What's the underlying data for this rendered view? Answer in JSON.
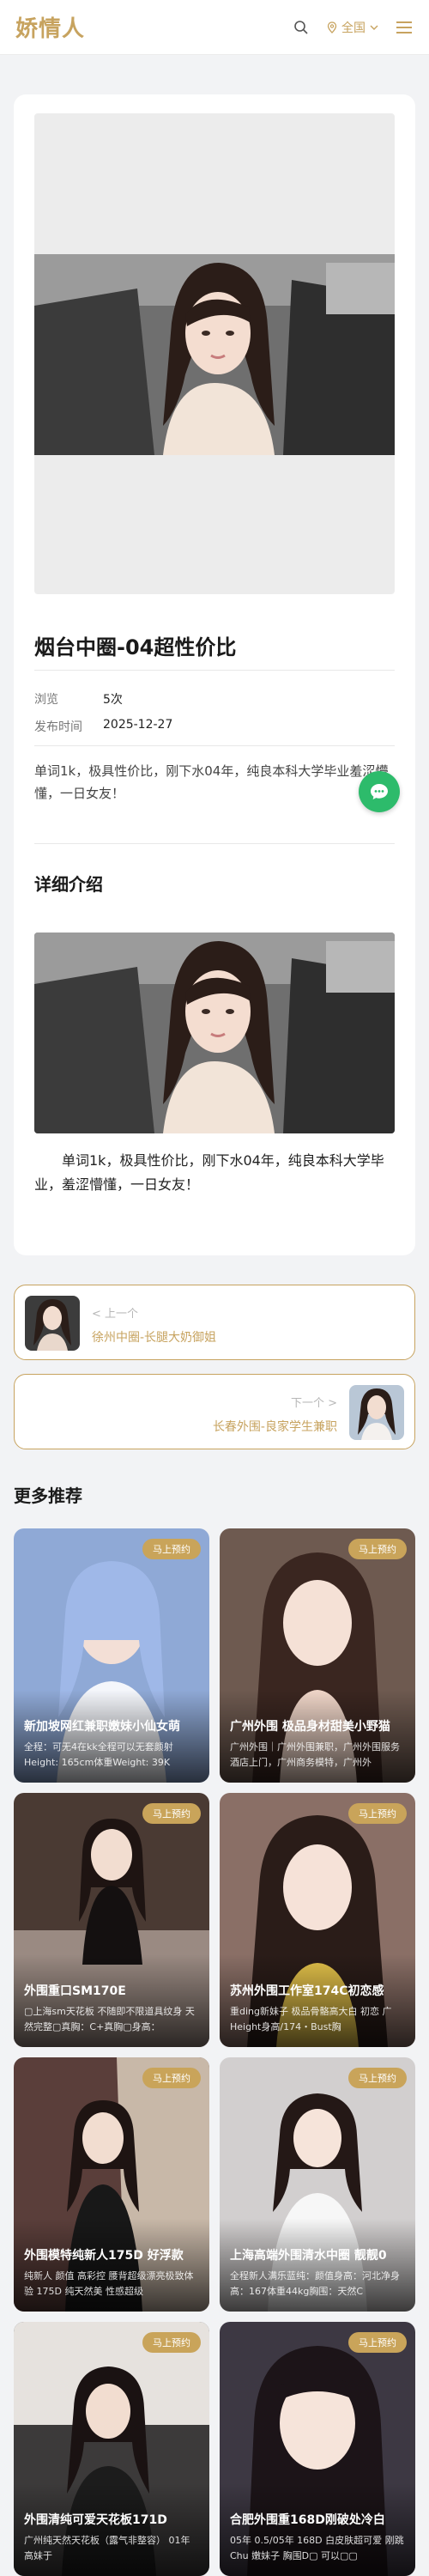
{
  "header": {
    "logo": "娇情人",
    "region_label": "全国",
    "icons": [
      "search-icon",
      "location-pin-icon",
      "chevron-down-icon",
      "menu-icon"
    ],
    "accent_color": "#c7a35f"
  },
  "post": {
    "title": "烟台中圈-04超性价比",
    "meta": [
      {
        "key": "浏览",
        "value": "5次"
      },
      {
        "key": "发布时间",
        "value": "2025-12-27"
      }
    ],
    "intro": "单词1k，极具性价比，刚下水04年，纯良本科大学毕业羞涩懵懂，一日女友！",
    "section_title": "详细介绍",
    "detail_text": "单词1k，极具性价比，刚下水04年，纯良本科大学毕业，羞涩懵懂，一日女友！"
  },
  "nav": {
    "prev_label": "< 上一个",
    "prev_title": "徐州中圈-长腿大奶御姐",
    "next_label": "下一个 >",
    "next_title": "长春外围-良家学生兼职"
  },
  "more": {
    "title": "更多推荐",
    "badge": "马上预约",
    "items": [
      {
        "title": "新加坡网红兼职嫩妹小仙女萌",
        "desc": "全程：可无4在kk全程可以无套颜射 Height: 165cm体重Weight: 39K",
        "bg": "#8fa9d6"
      },
      {
        "title": "广州外围 极品身材甜美小野猫",
        "desc": "广州外围｜广州外围兼职，广州外围服务酒店上门，广州商务模特，广州外",
        "bg": "#6e5a50"
      },
      {
        "title": "外围重口SM170E",
        "desc": "▢上海sm天花板 不随即不限道具纹身 天然完整▢真胸：C+真胸▢身高：",
        "bg": "#4a3a33"
      },
      {
        "title": "苏州外围工作室174C初恋感",
        "desc": "重ding新妹子 极品骨骼高大白 初恋 广 Height身高/174・Bust胸",
        "bg": "#8a6f66"
      },
      {
        "title": "外围模特纯新人175D 好浮款",
        "desc": "纯新人 颜值 高彩控 腰背超级漂亮极致体验 175D 纯天然美 性感超级",
        "bg": "#5a3e3a"
      },
      {
        "title": "上海高端外围清水中圈 靓靓0",
        "desc": "全程新人满乐蓝纯：颜值身高：河北净身高：167体重44kg胸围：天然C",
        "bg": "#d2cfcf"
      },
      {
        "title": "外围清纯可爱天花板171D",
        "desc": "广州纯天然天花板（露气非整容） 01年 高妹于",
        "bg": "#3c3a3a"
      },
      {
        "title": "合肥外围重168D刚破处冷白",
        "desc": "05年 0.5/05年 168D 白皮肤超可爱 刚跳Chu 嫩妹子 胸围D▢ 可以▢▢",
        "bg": "#3d3843"
      }
    ]
  },
  "chat_button_color": "#2dbb6b"
}
